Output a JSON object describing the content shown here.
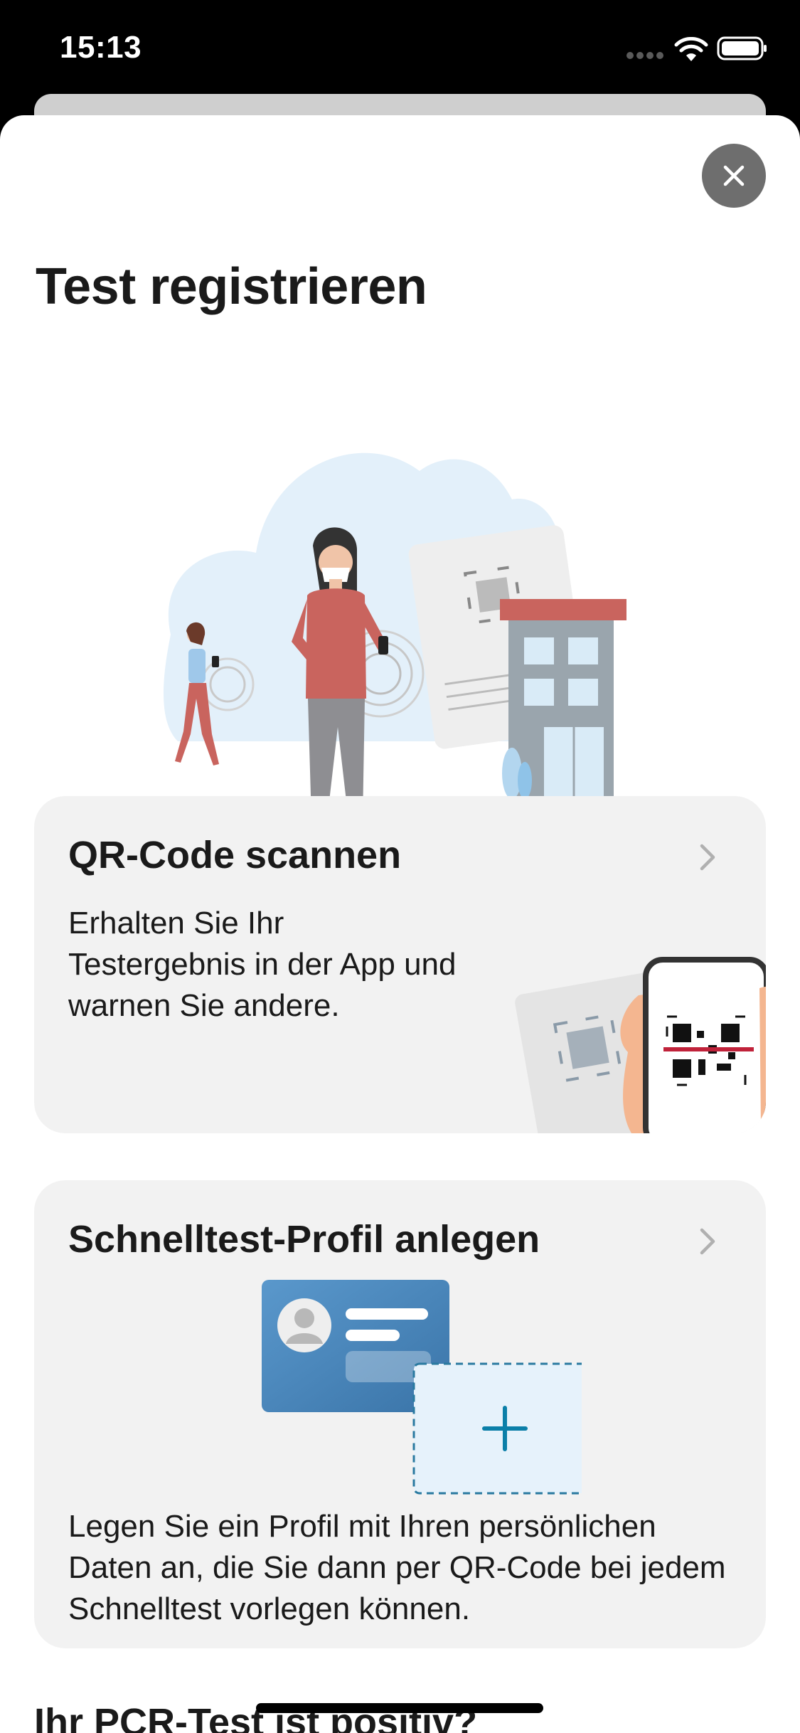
{
  "status_bar": {
    "time": "15:13",
    "icons": [
      "signal-dots-icon",
      "wifi-icon",
      "battery-icon"
    ]
  },
  "header": {
    "title": "Test registrieren",
    "close_icon": "close-icon"
  },
  "cards": {
    "qr": {
      "title": "QR-Code scannen",
      "description": "Erhalten Sie Ihr Testergebnis in der App und warnen Sie andere.",
      "chevron_icon": "chevron-right-icon"
    },
    "profile": {
      "title": "Schnelltest-Profil anlegen",
      "description": "Legen Sie ein Profil mit Ihren persönlichen Daten an, die Sie dann per QR-Code bei jedem Schnelltest vorlegen können.",
      "chevron_icon": "chevron-right-icon"
    }
  },
  "next_section": {
    "title": "Ihr PCR-Test ist positiv?"
  },
  "colors": {
    "sheet_background": "#ffffff",
    "card_background": "#f2f2f2",
    "close_button": "#6e6e6e",
    "accent_blue": "#0b7fa8",
    "text": "#1a1a1a"
  }
}
